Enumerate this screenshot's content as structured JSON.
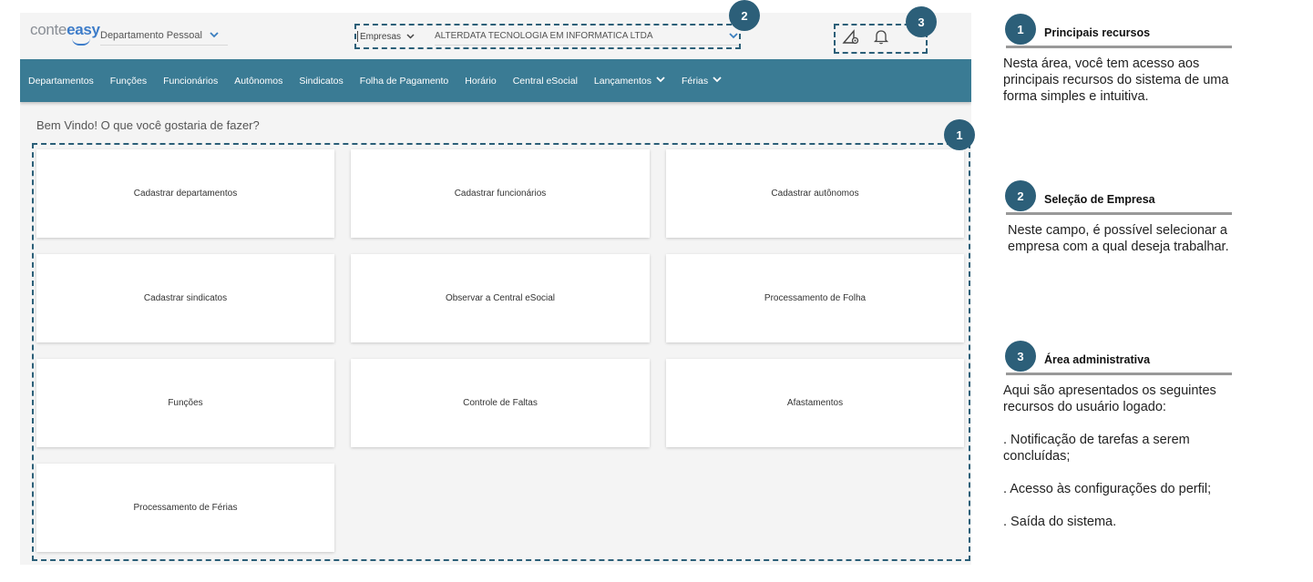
{
  "app": {
    "logo": {
      "part1": "conte",
      "part2": "easy"
    },
    "module_select": {
      "value": "Departamento Pessoal"
    },
    "company_select": {
      "label": "Empresas",
      "value": "ALTERDATA TECNOLOGIA EM INFORMATICA LTDA"
    },
    "admin": {
      "icons": [
        "settings-profile-icon",
        "bell-icon"
      ]
    },
    "nav": {
      "items": [
        {
          "label": "Departamentos",
          "dropdown": false
        },
        {
          "label": "Funções",
          "dropdown": false
        },
        {
          "label": "Funcionários",
          "dropdown": false
        },
        {
          "label": "Autônomos",
          "dropdown": false
        },
        {
          "label": "Sindicatos",
          "dropdown": false
        },
        {
          "label": "Folha de Pagamento",
          "dropdown": false
        },
        {
          "label": "Horário",
          "dropdown": false
        },
        {
          "label": "Central eSocial",
          "dropdown": false
        },
        {
          "label": "Lançamentos",
          "dropdown": true
        },
        {
          "label": "Férias",
          "dropdown": true
        }
      ]
    },
    "welcome": "Bem Vindo! O que você gostaria de fazer?",
    "cards": [
      "Cadastrar departamentos",
      "Cadastrar funcionários",
      "Cadastrar autônomos",
      "Cadastrar sindicatos",
      "Observar a Central eSocial",
      "Processamento de Folha",
      "Funções",
      "Controle de Faltas",
      "Afastamentos",
      "Processamento de Férias"
    ],
    "colors": {
      "nav": "#3a7b94",
      "badge": "#2c5f79",
      "accent": "#3d7cc9"
    }
  },
  "annotations": {
    "badges": [
      "1",
      "2",
      "3"
    ],
    "notes": [
      {
        "number": "1",
        "title": "Principais recursos",
        "lines": [
          "Nesta área, você tem acesso aos principais recursos do sistema de uma forma simples e intuitiva."
        ]
      },
      {
        "number": "2",
        "title": "Seleção de Empresa",
        "lines": [
          "Neste campo, é possível selecionar a empresa com a qual deseja trabalhar."
        ]
      },
      {
        "number": "3",
        "title": "Área administrativa",
        "lines": [
          "Aqui são apresentados os seguintes recursos do usuário logado:",
          ". Notificação de tarefas a serem concluídas;",
          ". Acesso às configurações do perfil;",
          ". Saída do sistema."
        ]
      }
    ]
  }
}
